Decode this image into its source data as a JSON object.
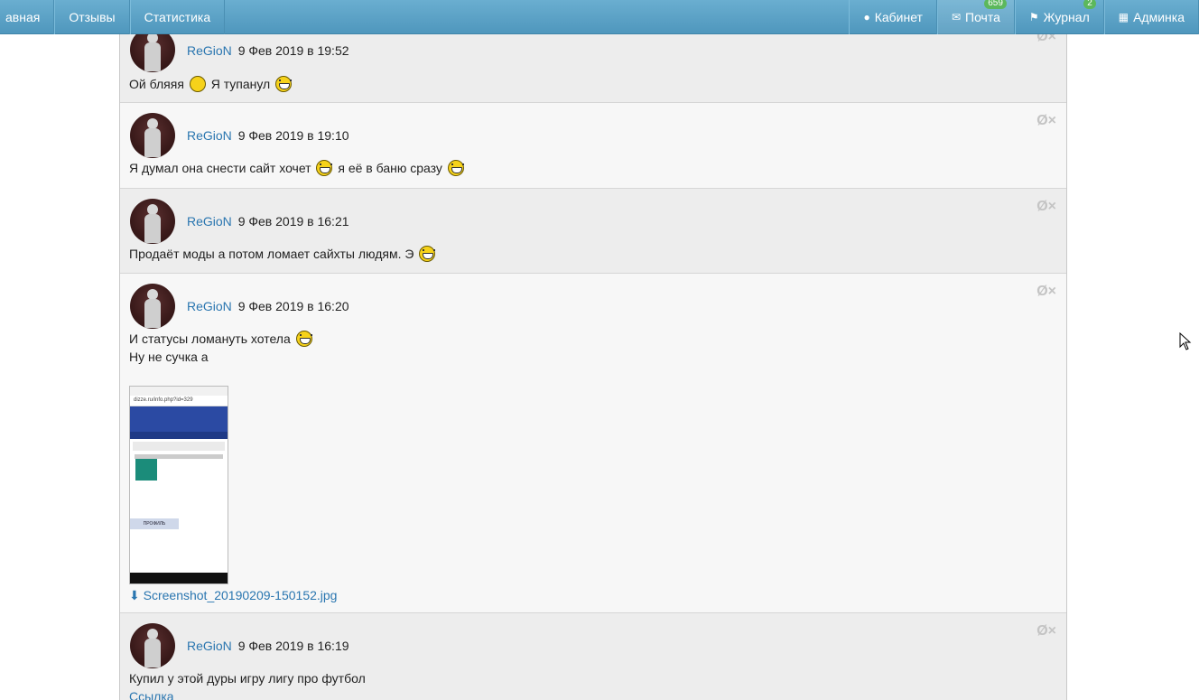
{
  "nav": {
    "left": [
      {
        "label": "авная"
      },
      {
        "label": "Отзывы"
      },
      {
        "label": "Статистика"
      }
    ],
    "right": [
      {
        "label": "Кабинет",
        "icon": "user-icon"
      },
      {
        "label": "Почта",
        "icon": "envelope-icon",
        "badge": "659"
      },
      {
        "label": "Журнал",
        "icon": "bell-icon",
        "badge": "2"
      },
      {
        "label": "Админка",
        "icon": "grid-icon"
      }
    ]
  },
  "posts": [
    {
      "author": "ReGioN",
      "date": "9 Фев 2019 в 19:52",
      "lines": [
        "Ой бляяя",
        "Я тупанул"
      ]
    },
    {
      "author": "ReGioN",
      "date": "9 Фев 2019 в 19:10",
      "lines": [
        "Я думал она снести сайт хочет",
        "я её в баню сразу"
      ]
    },
    {
      "author": "ReGioN",
      "date": "9 Фев 2019 в 16:21",
      "lines": [
        "Продаёт моды а потом ломает сайхты людям. Э"
      ]
    },
    {
      "author": "ReGioN",
      "date": "9 Фев 2019 в 16:20",
      "lines": [
        "И статусы ломануть хотела",
        "Ну не сучка а"
      ],
      "attachment": "Screenshot_20190209-150152.jpg"
    },
    {
      "author": "ReGioN",
      "date": "9 Фев 2019 в 16:19",
      "lines": [
        "Купил у этой дуры игру лигу про футбол",
        "Ссылка"
      ]
    }
  ],
  "post_actions": {
    "block": "Ø",
    "delete": "×"
  },
  "thumbnail": {
    "url": "dizze.ru/info.php?id=329",
    "profile_tab": "ПРОФИЛЬ"
  },
  "colors": {
    "nav": "#5aa0c5",
    "link": "#2a76b0",
    "badge": "#5cb85c"
  }
}
